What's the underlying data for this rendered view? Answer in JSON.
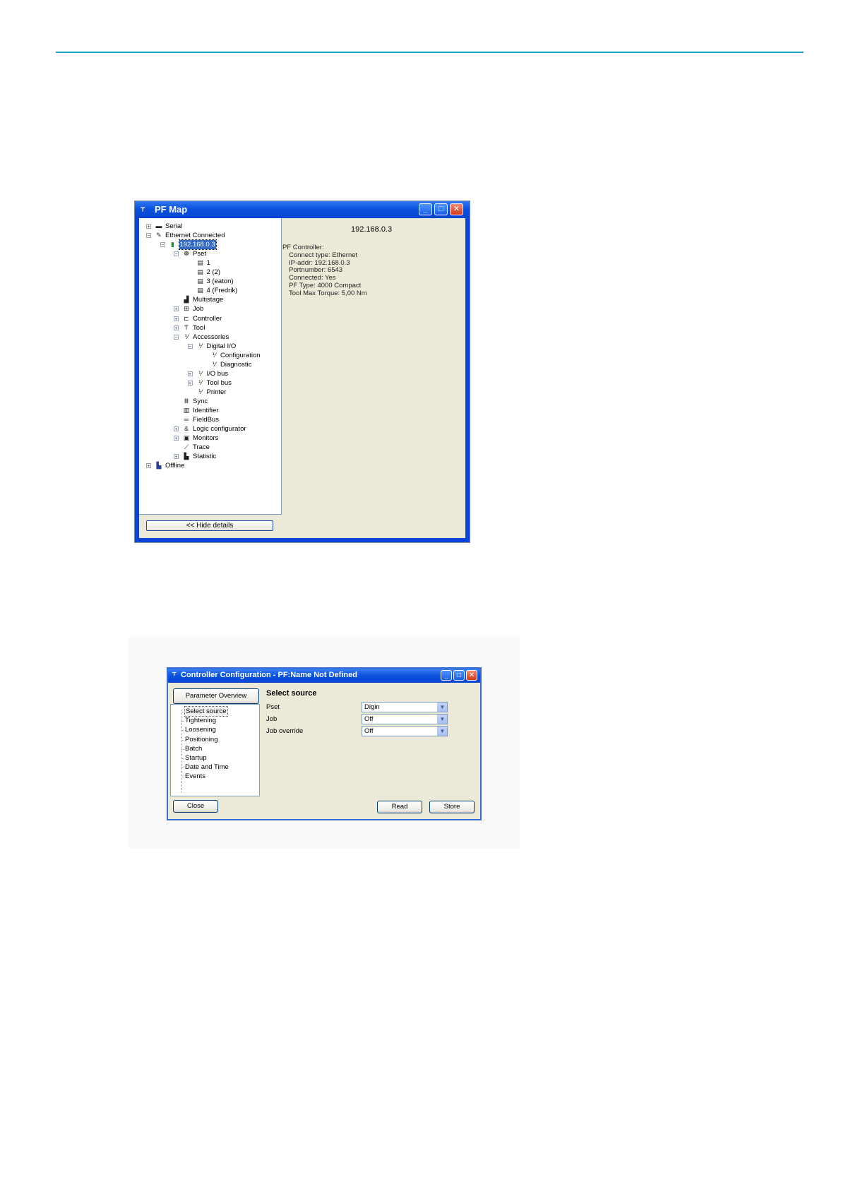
{
  "pfmap": {
    "title": "PF Map",
    "tree": [
      {
        "label": "Serial",
        "toggle": "+",
        "icon": "serial-icon",
        "glyph": "▬"
      },
      {
        "label": "Ethernet Connected",
        "toggle": "−",
        "icon": "ethernet-icon",
        "glyph": "✎"
      },
      {
        "label": "192.168.0.3",
        "toggle": "−",
        "icon": "controller-icon",
        "glyph": "▮"
      },
      {
        "label": "Pset",
        "toggle": "−",
        "icon": "pset-icon",
        "glyph": "☸"
      },
      {
        "label": "1",
        "toggle": "",
        "icon": "doc-icon",
        "glyph": "▤"
      },
      {
        "label": "2 (2)",
        "toggle": "",
        "icon": "doc-icon",
        "glyph": "▤"
      },
      {
        "label": "3 (eaton)",
        "toggle": "",
        "icon": "doc-icon",
        "glyph": "▤"
      },
      {
        "label": "4 (Fredrik)",
        "toggle": "",
        "icon": "doc-icon",
        "glyph": "▤"
      },
      {
        "label": "Multistage",
        "toggle": "",
        "icon": "multistage-icon",
        "glyph": "▟"
      },
      {
        "label": "Job",
        "toggle": "+",
        "icon": "job-icon",
        "glyph": "⊞"
      },
      {
        "label": "Controller",
        "toggle": "+",
        "icon": "controller-config-icon",
        "glyph": "⊏"
      },
      {
        "label": "Tool",
        "toggle": "+",
        "icon": "tool-icon",
        "glyph": "Ƭ"
      },
      {
        "label": "Accessories",
        "toggle": "−",
        "icon": "io-icon",
        "glyph": "⅟"
      },
      {
        "label": "Digital I/O",
        "toggle": "−",
        "icon": "io-icon",
        "glyph": "⅟"
      },
      {
        "label": "Configuration",
        "toggle": "",
        "icon": "io-icon",
        "glyph": "⅟"
      },
      {
        "label": "Diagnostic",
        "toggle": "",
        "icon": "io-icon",
        "glyph": "⅟"
      },
      {
        "label": "I/O bus",
        "toggle": "+",
        "icon": "io-icon",
        "glyph": "⅟"
      },
      {
        "label": "Tool bus",
        "toggle": "+",
        "icon": "io-icon",
        "glyph": "⅟"
      },
      {
        "label": "Printer",
        "toggle": "",
        "icon": "io-icon",
        "glyph": "⅟"
      },
      {
        "label": "Sync",
        "toggle": "",
        "icon": "sync-icon",
        "glyph": "Ⅲ"
      },
      {
        "label": "Identifier",
        "toggle": "",
        "icon": "barcode-icon",
        "glyph": "▥"
      },
      {
        "label": "FieldBus",
        "toggle": "",
        "icon": "fieldbus-icon",
        "glyph": "═"
      },
      {
        "label": "Logic configurator",
        "toggle": "+",
        "icon": "logic-icon",
        "glyph": "&"
      },
      {
        "label": "Monitors",
        "toggle": "+",
        "icon": "monitor-icon",
        "glyph": "▣"
      },
      {
        "label": "Trace",
        "toggle": "",
        "icon": "trace-icon",
        "glyph": "⟋"
      },
      {
        "label": "Statistic",
        "toggle": "+",
        "icon": "statistic-icon",
        "glyph": "▙"
      },
      {
        "label": "Offline",
        "toggle": "+",
        "icon": "offline-icon",
        "glyph": "▙"
      }
    ],
    "hide_details": "<< Hide details",
    "detail_ip": "192.168.0.3",
    "details": [
      "PF Controller:",
      "Connect type: Ethernet",
      "IP-addr: 192.168.0.3",
      "Portnumber: 6543",
      "Connected: Yes",
      "PF Type:  4000 Compact",
      "Tool Max Torque: 5,00 Nm"
    ]
  },
  "cc": {
    "title": "Controller Configuration - PF:Name Not Defined",
    "param_overview": "Parameter Overview",
    "nav": [
      "Select source",
      "Tightening",
      "Loosening",
      "Positioning",
      "Batch",
      "Startup",
      "Date and Time",
      "Events"
    ],
    "section_title": "Select source",
    "fields": [
      {
        "label": "Pset",
        "value": "Digin"
      },
      {
        "label": "Job",
        "value": "Off"
      },
      {
        "label": "Job override",
        "value": "Off"
      }
    ],
    "close": "Close",
    "read": "Read",
    "store": "Store"
  },
  "colors": {
    "rule": "#19aac8",
    "xp_title": "#0b52dd",
    "selection": "#316ac5"
  }
}
